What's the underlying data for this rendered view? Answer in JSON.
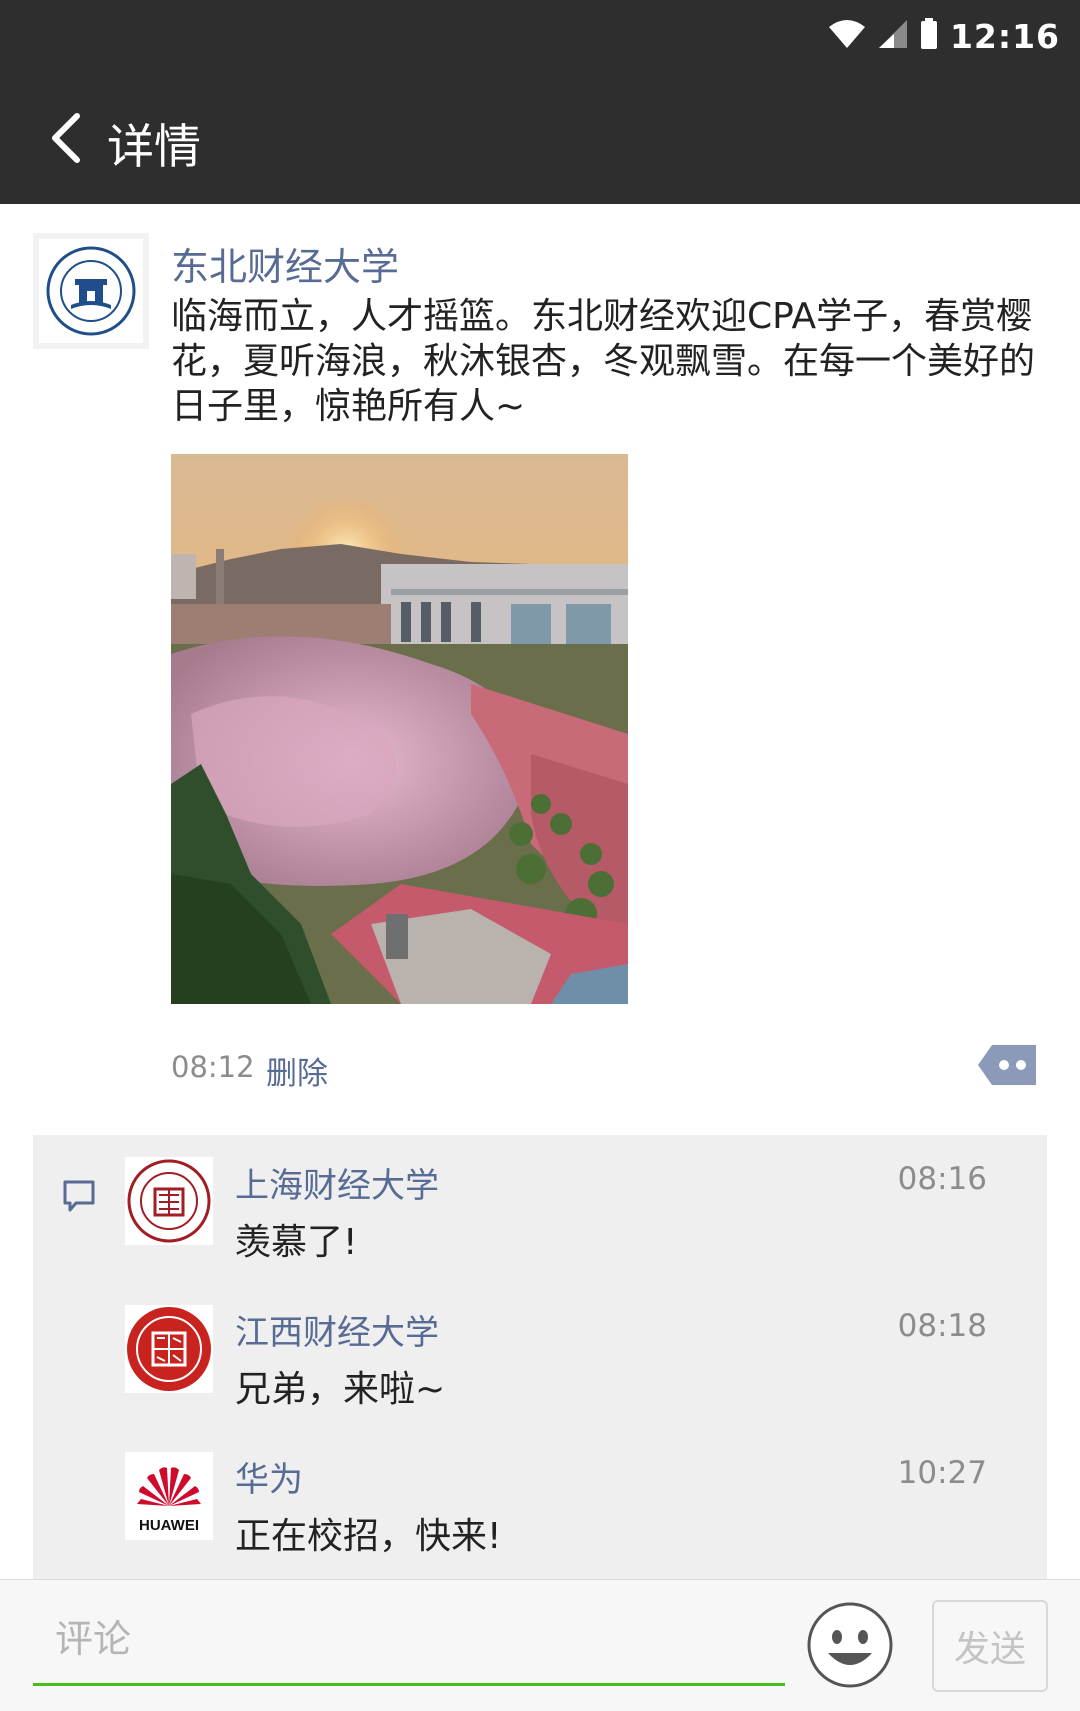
{
  "status_bar": {
    "time": "12:16"
  },
  "nav": {
    "title": "详情"
  },
  "post": {
    "author": "东北财经大学",
    "text": "临海而立，人才摇篮。东北财经欢迎CPA学子，春赏樱花，夏听海浪，秋沐银杏，冬观飘雪。在每一个美好的日子里，惊艳所有人~",
    "time": "08:12",
    "delete_label": "删除"
  },
  "comments": [
    {
      "name": "上海财经大学",
      "time": "08:16",
      "text": "羡慕了!"
    },
    {
      "name": "江西财经大学",
      "time": "08:18",
      "text": "兄弟，来啦~"
    },
    {
      "name": "华为",
      "time": "10:27",
      "text": "正在校招，快来!"
    }
  ],
  "huawei_logo_text": "HUAWEI",
  "input": {
    "placeholder": "评论",
    "send_label": "发送"
  },
  "colors": {
    "link": "#576b95",
    "bar": "#2e2e2e",
    "accent": "#45c01a"
  }
}
